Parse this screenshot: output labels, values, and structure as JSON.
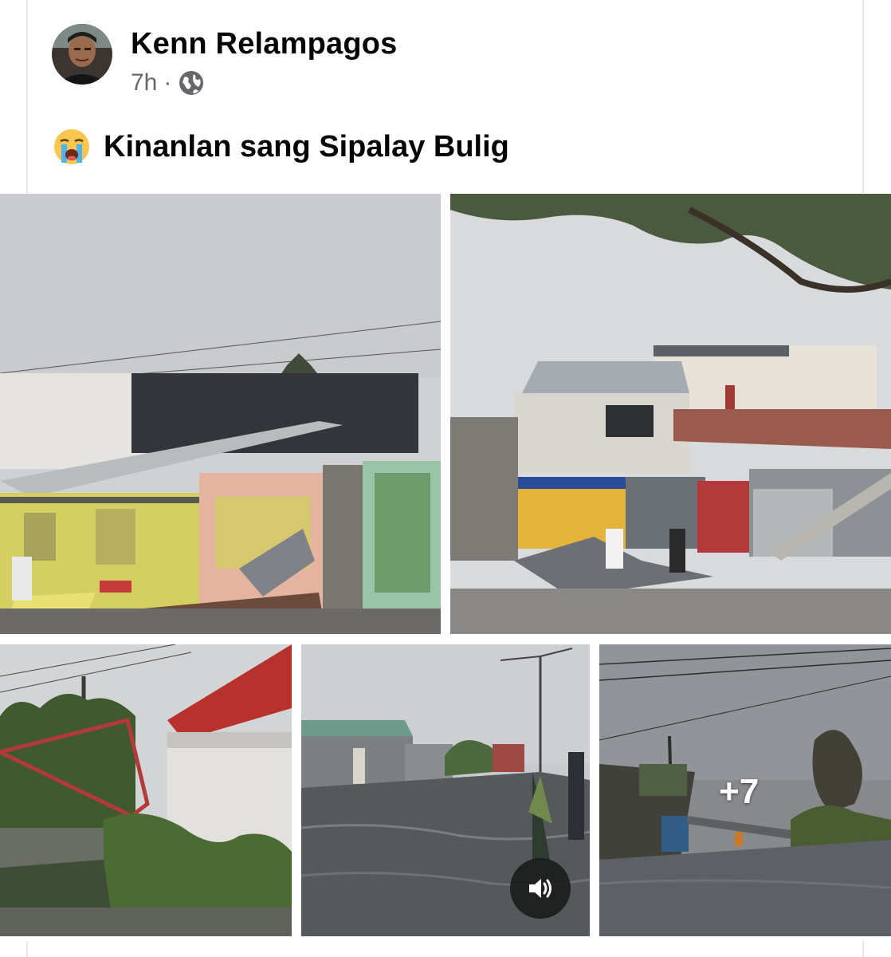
{
  "post": {
    "author_name": "Kenn Relampagos",
    "timestamp": "7h",
    "separator": "·",
    "privacy_icon": "globe-icon",
    "caption_emoji": "loudly-crying-face-emoji",
    "caption_text": "Kinanlan sang Sipalay Bulig"
  },
  "photos": {
    "more_count": "+7",
    "sound_icon": "speaker-icon"
  },
  "colors": {
    "text_primary": "#050505",
    "text_secondary": "#65676b",
    "divider": "#e4e6eb",
    "overlay_text": "#ffffff"
  }
}
